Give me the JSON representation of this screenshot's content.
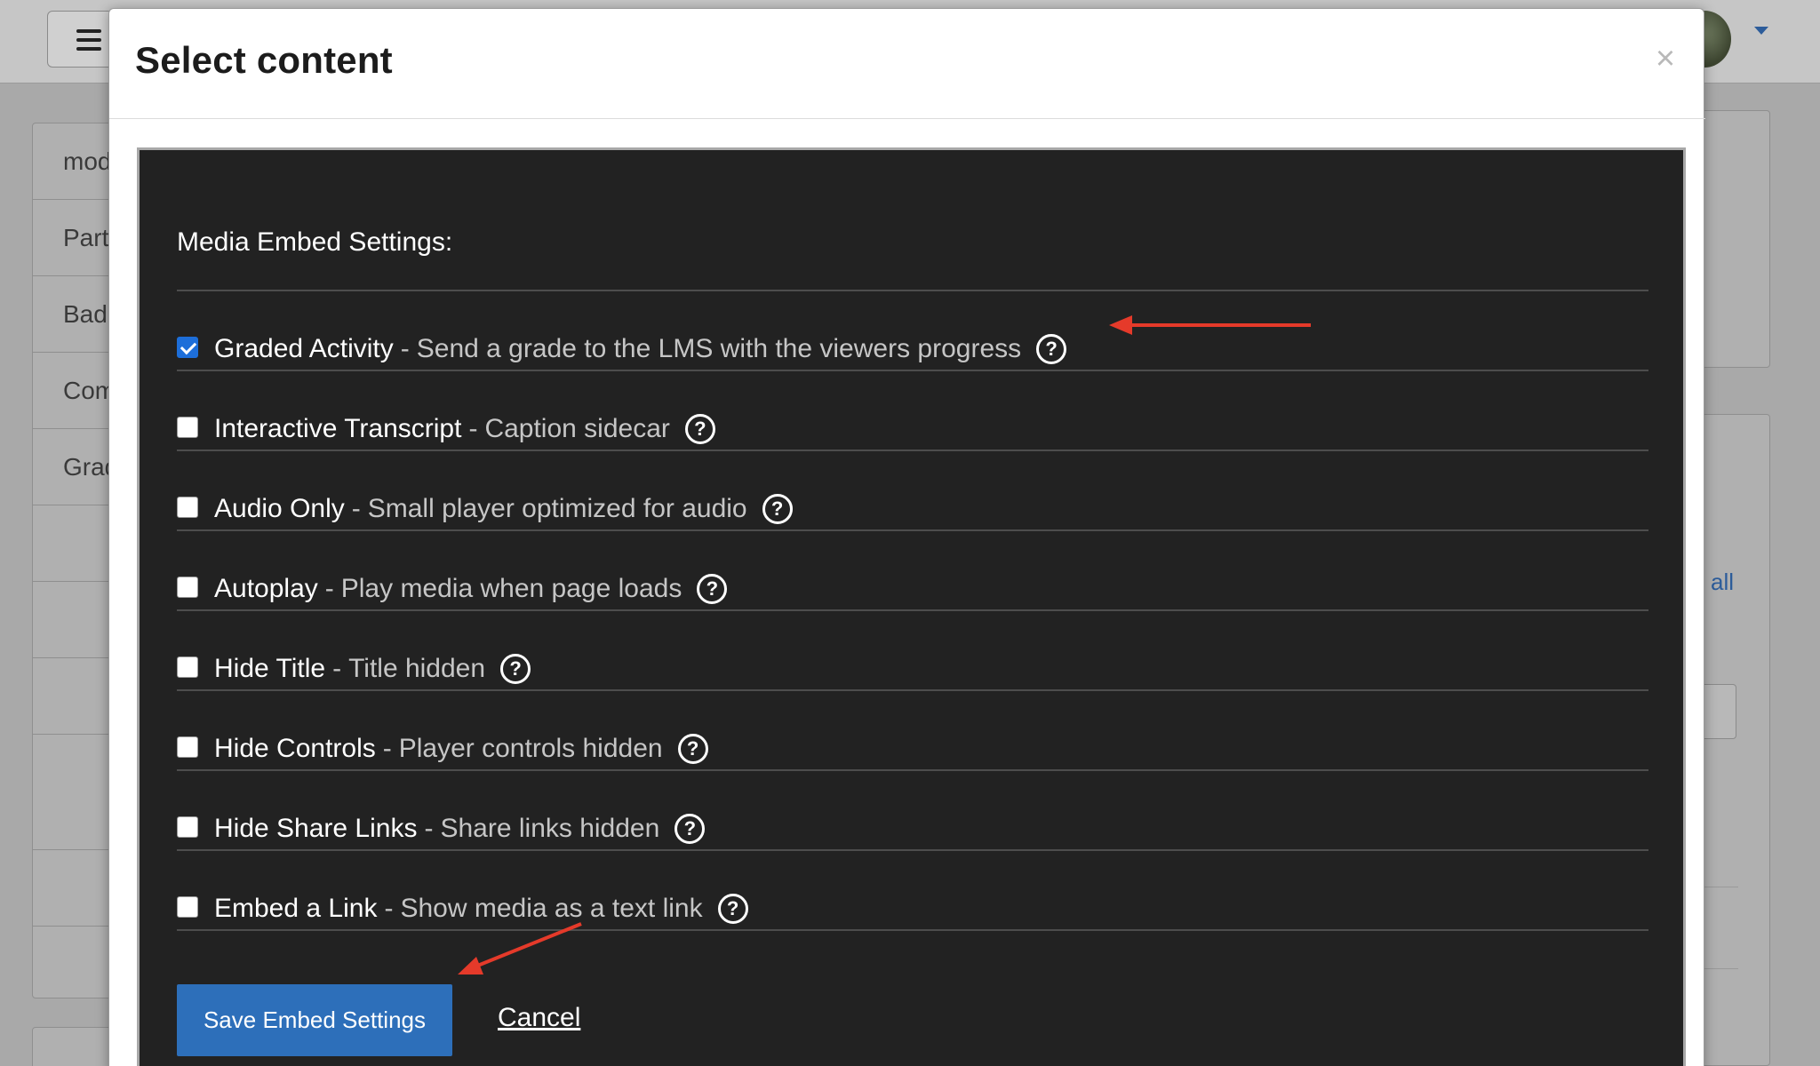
{
  "background": {
    "left_nav_items": [
      "mod",
      "Part",
      "Bad",
      "Com",
      "Grad"
    ],
    "right_link": "all"
  },
  "modal": {
    "title": "Select content",
    "close_glyph": "×",
    "embed_settings": {
      "heading": "Media Embed Settings:",
      "separator": "-",
      "options": [
        {
          "label": "Graded Activity",
          "description": "Send a grade to the LMS with the viewers progress",
          "checked": true
        },
        {
          "label": "Interactive Transcript",
          "description": "Caption sidecar",
          "checked": false
        },
        {
          "label": "Audio Only",
          "description": "Small player optimized for audio",
          "checked": false
        },
        {
          "label": "Autoplay",
          "description": "Play media when page loads",
          "checked": false
        },
        {
          "label": "Hide Title",
          "description": "Title hidden",
          "checked": false
        },
        {
          "label": "Hide Controls",
          "description": "Player controls hidden",
          "checked": false
        },
        {
          "label": "Hide Share Links",
          "description": "Share links hidden",
          "checked": false
        },
        {
          "label": "Embed a Link",
          "description": "Show media as a text link",
          "checked": false
        }
      ],
      "help_glyph": "?",
      "save_label": "Save Embed Settings",
      "cancel_label": "Cancel"
    }
  },
  "colors": {
    "panel_bg": "#222222",
    "accent_blue": "#2d6fba",
    "checkbox_blue": "#1d6ed9",
    "annotation_red": "#e53a2a"
  }
}
